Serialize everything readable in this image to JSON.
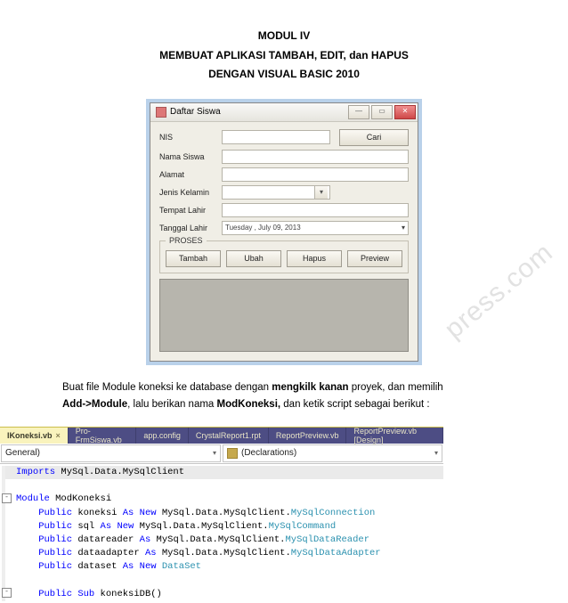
{
  "heading": {
    "line1": "MODUL IV",
    "line2": "MEMBUAT APLIKASI TAMBAH, EDIT, dan HAPUS",
    "line3": "DENGAN VISUAL BASIC 2010"
  },
  "form": {
    "title": "Daftar Siswa",
    "labels": {
      "nis": "NIS",
      "nama": "Nama Siswa",
      "alamat": "Alamat",
      "jk": "Jenis Kelamin",
      "tlahir": "Tempat Lahir",
      "tgllahir": "Tanggal Lahir"
    },
    "date_value": "Tuesday  ,    July      09, 2013",
    "date_arrow": "▾",
    "btn_cari": "Cari",
    "group": {
      "title": "PROSES",
      "tambah": "Tambah",
      "ubah": "Ubah",
      "hapus": "Hapus",
      "preview": "Preview"
    },
    "win_min": "—",
    "win_max": "▭",
    "win_close": "✕"
  },
  "paragraph": {
    "p1a": "Buat file Module koneksi ke database dengan ",
    "p1b": "mengkilk kanan",
    "p1c": " proyek, dan memilih ",
    "p2a": "Add->Module",
    "p2b": ", lalu berikan nama ",
    "p2c": "ModKoneksi,",
    "p2d": " dan ketik script sebagai berikut :"
  },
  "ide": {
    "tabs": [
      "IKoneksi.vb",
      "Pro-FrmSiswa.vb",
      "app.config",
      "CrystalReport1.rpt",
      "ReportPreview.vb",
      "ReportPreview.vb [Design]"
    ],
    "dd_left": "General)",
    "dd_right": "(Declarations)",
    "code": {
      "l1a": "Imports",
      "l1b": " MySql.Data.MySqlClient",
      "l2a": "Module",
      "l2b": " ModKoneksi",
      "l3a": "    Public",
      "l3b": " koneksi ",
      "l3c": "As",
      "l3d": " New",
      "l3e": " MySql.Data.MySqlClient.",
      "l3f": "MySqlConnection",
      "l4a": "    Public",
      "l4b": " sql ",
      "l4c": "As",
      "l4d": " New",
      "l4e": " MySql.Data.MySqlClient.",
      "l4f": "MySqlCommand",
      "l5a": "    Public",
      "l5b": " datareader ",
      "l5c": "As",
      "l5d": " MySql.Data.MySqlClient.",
      "l5f": "MySqlDataReader",
      "l6a": "    Public",
      "l6b": " dataadapter ",
      "l6c": "As",
      "l6d": " MySql.Data.MySqlClient.",
      "l6f": "MySqlDataAdapter",
      "l7a": "    Public",
      "l7b": " dataset ",
      "l7c": "As",
      "l7d": " New",
      "l7e": " DataSet",
      "l8a": "    Public",
      "l8b": " Sub",
      "l8c": " koneksiDB()"
    }
  },
  "watermark": "press.com"
}
